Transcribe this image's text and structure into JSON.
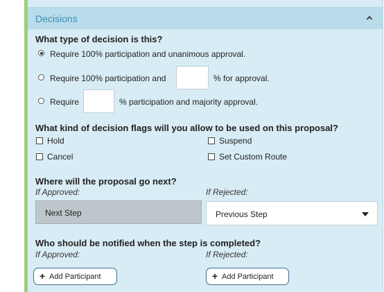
{
  "panel": {
    "title": "Decisions",
    "collapse_icon": "chevron-up-icon"
  },
  "decision_type": {
    "question": "What type of decision is this?",
    "option1": "Require 100% participation and unanimous approval.",
    "option2_before": "Require 100% participation and",
    "option2_after": "% for approval.",
    "option2_value": "",
    "option3_before": "Require",
    "option3_after": "% participation and majority approval.",
    "option3_value": "",
    "selected": 1
  },
  "flags": {
    "question": "What kind of decision flags will you allow to be used on this proposal?",
    "hold": "Hold",
    "suspend": "Suspend",
    "cancel": "Cancel",
    "set_custom_route": "Set Custom Route"
  },
  "routing": {
    "question": "Where will the proposal go next?",
    "if_approved_label": "If Approved:",
    "if_rejected_label": "If Rejected:",
    "approved_value": "Next Step",
    "rejected_value": "Previous Step"
  },
  "notify": {
    "question": "Who should be notified when the step is completed?",
    "if_approved_label": "If Approved:",
    "if_rejected_label": "If Rejected:",
    "add_approved": "Add Participant",
    "add_rejected": "Add Participant"
  }
}
